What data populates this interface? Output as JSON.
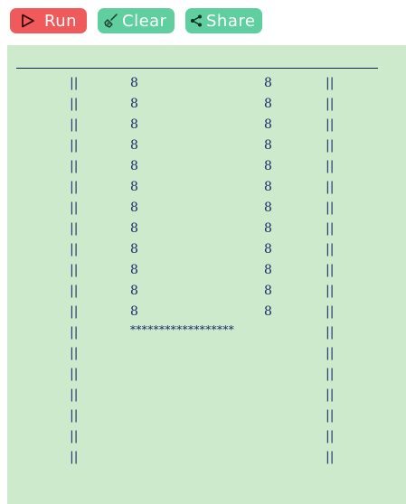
{
  "toolbar": {
    "run_label": "Run",
    "clear_label": "Clear",
    "share_label": "Share",
    "run_icon": "play-icon",
    "clear_icon": "broom-icon",
    "share_icon": "share-icon",
    "run_color": "#f05a5a",
    "clear_color": "#5fcf9f",
    "share_color": "#5fcf9f"
  },
  "output": {
    "background": "#cdeacd",
    "rule": "________________________________________________",
    "left_wall": [
      "||",
      "||",
      "||",
      "||",
      "||",
      "||",
      "||",
      "||",
      "||",
      "||",
      "||",
      "||",
      "||",
      "||",
      "||",
      "||",
      "||",
      "||",
      "||"
    ],
    "right_wall": [
      "||",
      "||",
      "||",
      "||",
      "||",
      "||",
      "||",
      "||",
      "||",
      "||",
      "||",
      "||",
      "||",
      "||",
      "||",
      "||",
      "||",
      "||",
      "||"
    ],
    "inner_left": [
      "8",
      "8",
      "8",
      "8",
      "8",
      "8",
      "8",
      "8",
      "8",
      "8",
      "8",
      "8"
    ],
    "inner_right": [
      "8",
      "8",
      "8",
      "8",
      "8",
      "8",
      "8",
      "8",
      "8",
      "8",
      "8",
      "8"
    ],
    "stars": "******************"
  }
}
